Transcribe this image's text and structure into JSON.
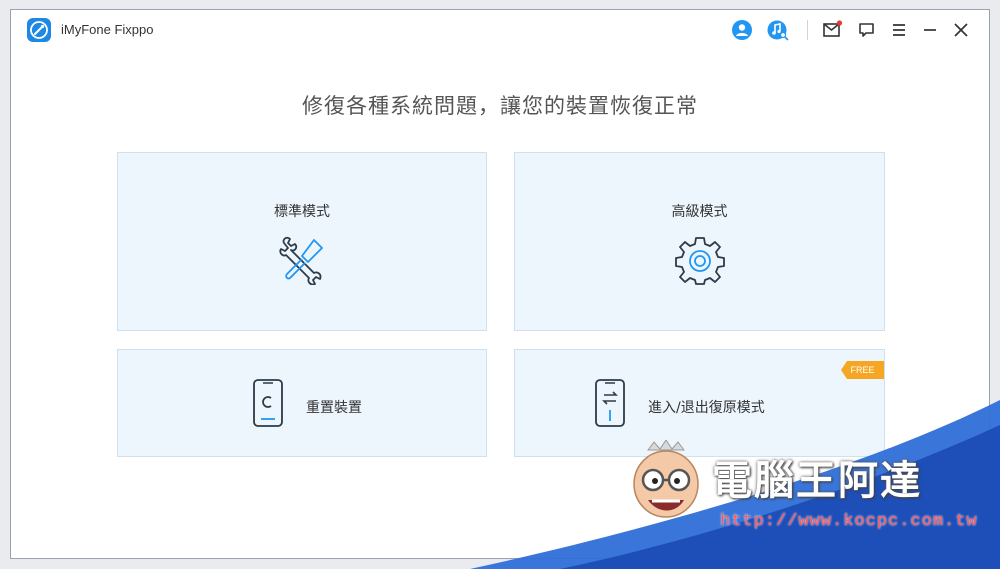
{
  "window": {
    "app_title": "iMyFone Fixppo",
    "toolbar_icons": [
      "user-icon",
      "music-search-icon",
      "mail-icon",
      "feedback-icon",
      "menu-icon",
      "minimize-icon",
      "close-icon"
    ]
  },
  "main": {
    "heading": "修復各種系統問題，讓您的裝置恢復正常",
    "cards": [
      {
        "label": "標準模式",
        "icon": "tools-icon"
      },
      {
        "label": "高級模式",
        "icon": "gear-icon"
      },
      {
        "label": "重置裝置",
        "icon": "phone-reset-icon"
      },
      {
        "label": "進入/退出復原模式",
        "icon": "phone-recovery-icon",
        "badge": "FREE"
      }
    ]
  },
  "watermark": {
    "text": "電腦王阿達",
    "url": "http://www.kocpc.com.tw"
  },
  "colors": {
    "accent": "#1e88e5",
    "card_bg": "#eef6fd",
    "badge": "#f5a623",
    "notification_dot": "#e53935"
  }
}
